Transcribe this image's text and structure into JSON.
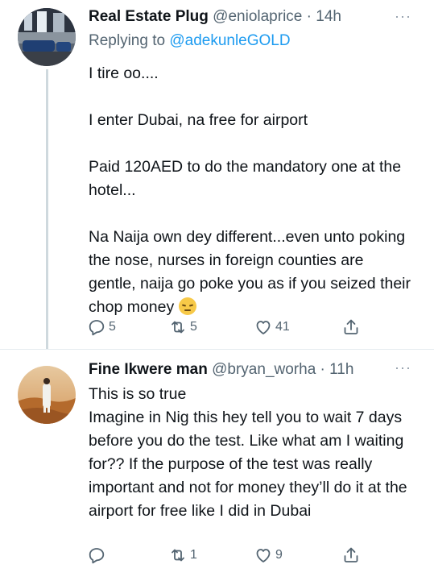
{
  "tweets": [
    {
      "name": "Real Estate Plug",
      "handle": "@eniolaprice",
      "time": "· 14h",
      "replying_prefix": "Replying to",
      "replying_to": "@adekunleGOLD",
      "paragraphs": [
        "I tire oo....",
        "I enter Dubai, na free for airport",
        "Paid 120AED to do the mandatory one at the hotel...",
        "Na Naija own dey different...even unto poking the nose, nurses in foreign counties are gentle, naija go poke you as if you seized their chop money"
      ],
      "emoji": "pensive-face-emoji",
      "reply_count": "5",
      "retweet_count": "5",
      "like_count": "41",
      "more": "···"
    },
    {
      "name": "Fine Ikwere man",
      "handle": "@bryan_worha",
      "time": "· 11h",
      "lines": [
        "This is so true",
        "Imagine in Nig this hey tell you to wait 7 days before you do the test. Like what am I waiting for?? If the purpose of the test was really important and not for money they’ll do it at the airport for free like I did in Dubai"
      ],
      "reply_count": "",
      "retweet_count": "1",
      "like_count": "9",
      "more": "···"
    }
  ],
  "colors": {
    "link": "#1d9bf0",
    "secondary_text": "#536471",
    "thread_line": "#cfd9de"
  }
}
